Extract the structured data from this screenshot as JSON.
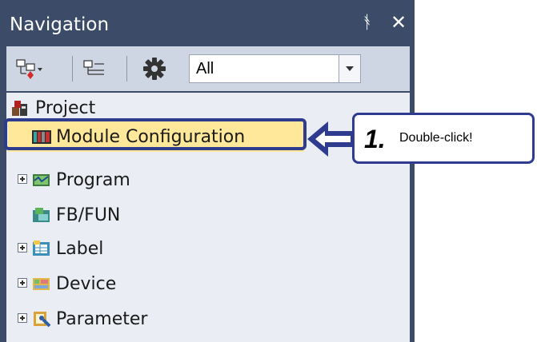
{
  "window": {
    "title": "Navigation",
    "pin_icon": "pin-icon",
    "close_icon": "close-icon"
  },
  "toolbar": {
    "filter_value": "All",
    "buttons": [
      "expand-collapse-icon",
      "tree-view-icon",
      "settings-icon"
    ]
  },
  "tree": {
    "root": {
      "label": "Project",
      "icon": "project-icon"
    },
    "items": [
      {
        "label": "Module Configuration",
        "icon": "module-configuration-icon",
        "expandable": false,
        "selected": true
      },
      {
        "label": "Program",
        "icon": "program-icon",
        "expandable": true
      },
      {
        "label": "FB/FUN",
        "icon": "fb-fun-icon",
        "expandable": false
      },
      {
        "label": "Label",
        "icon": "label-icon",
        "expandable": true
      },
      {
        "label": "Device",
        "icon": "device-icon",
        "expandable": true
      },
      {
        "label": "Parameter",
        "icon": "parameter-icon",
        "expandable": true
      }
    ]
  },
  "callout": {
    "step": "1.",
    "text": "Double-click!"
  },
  "colors": {
    "panel": "#3b4b68",
    "toolbar": "#cfd6e3",
    "tree_bg": "#eaedf3",
    "highlight": "#ffe89a",
    "accent": "#2f3b8f"
  }
}
